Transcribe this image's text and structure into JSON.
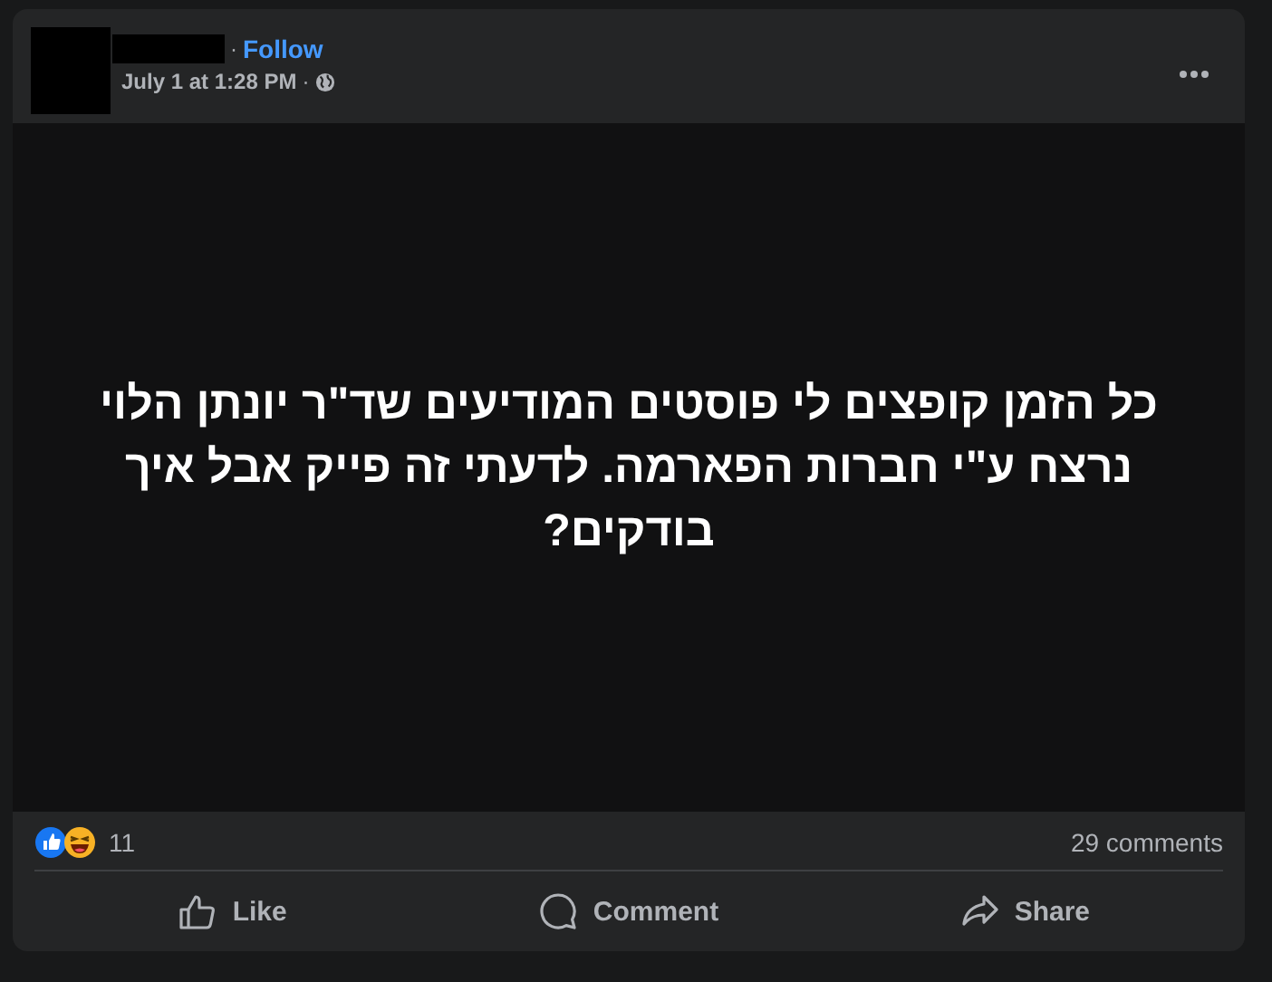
{
  "post": {
    "follow_separator": "·",
    "follow": "Follow",
    "timestamp": "July 1 at 1:28 PM",
    "timestamp_separator": "·",
    "body_text": "כל הזמן קופצים לי פוסטים המודיעים שד\"ר יונתן הלוי נרצח ע\"י חברות הפארמה. לדעתי זה פייק אבל איך בודקים?",
    "reaction_count": "11",
    "comments_count": "29 comments",
    "like_button": {
      "label": "Like"
    },
    "comment_button": {
      "label": "Comment"
    },
    "share_button": {
      "label": "Share"
    }
  }
}
